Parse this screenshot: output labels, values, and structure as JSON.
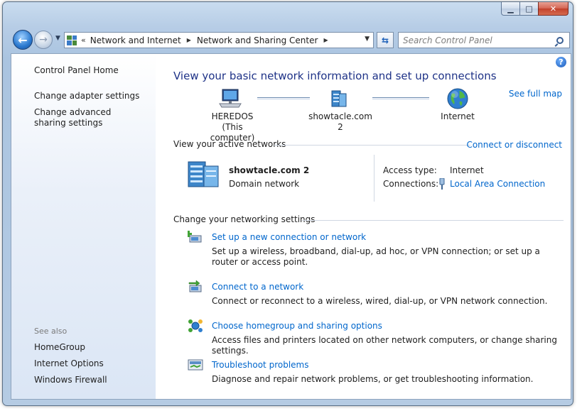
{
  "window": {
    "minimize_glyph": "▁",
    "maximize_glyph": "□",
    "close_glyph": "✕"
  },
  "nav": {
    "back_glyph": "←",
    "forward_glyph": "→",
    "dropdown_glyph": "▼"
  },
  "address": {
    "chevron": "«",
    "crumbs": [
      "Network and Internet",
      "Network and Sharing Center"
    ],
    "separator": "▶",
    "dropdown_glyph": "▼",
    "refresh_glyph": "⇆"
  },
  "search": {
    "placeholder": "Search Control Panel"
  },
  "sidebar": {
    "home": "Control Panel Home",
    "links": [
      "Change adapter settings",
      "Change advanced sharing settings"
    ],
    "see_also_label": "See also",
    "see_also": [
      "HomeGroup",
      "Internet Options",
      "Windows Firewall"
    ]
  },
  "main": {
    "help_glyph": "?",
    "title": "View your basic network information and set up connections",
    "see_full_map": "See full map",
    "map": {
      "computer_name": "HEREDOS",
      "computer_sub": "(This computer)",
      "domain": "showtacle.com  2",
      "internet": "Internet"
    },
    "active_header": "View your active networks",
    "connect_disconnect": "Connect or disconnect",
    "active_network": {
      "name": "showtacle.com  2",
      "type": "Domain network",
      "access_type_label": "Access type:",
      "access_type_value": "Internet",
      "connections_label": "Connections:",
      "connections_value": "Local Area Connection"
    },
    "settings_header": "Change your networking settings",
    "tasks": [
      {
        "link": "Set up a new connection or network",
        "desc": "Set up a wireless, broadband, dial-up, ad hoc, or VPN connection; or set up a router or access point."
      },
      {
        "link": "Connect to a network",
        "desc": "Connect or reconnect to a wireless, wired, dial-up, or VPN network connection."
      },
      {
        "link": "Choose homegroup and sharing options",
        "desc": "Access files and printers located on other network computers, or change sharing settings."
      },
      {
        "link": "Troubleshoot problems",
        "desc": "Diagnose and repair network problems, or get troubleshooting information."
      }
    ]
  },
  "colors": {
    "title_blue": "#1e3287",
    "link_blue": "#0066cc",
    "chrome": "#b7cde6",
    "sidebar": "#dbe6f5"
  }
}
